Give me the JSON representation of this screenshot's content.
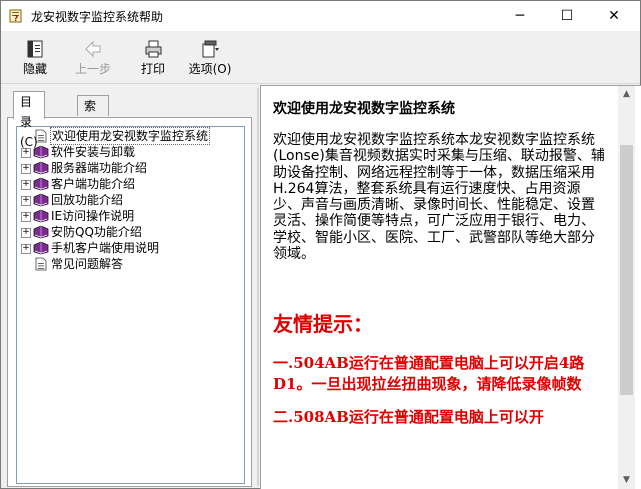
{
  "window": {
    "title": "龙安视数字监控系统帮助",
    "controls": {
      "minimize": "─",
      "maximize": "☐",
      "close": "✕"
    }
  },
  "toolbar": {
    "hide_label": "隐藏",
    "back_label": "上一步",
    "print_label": "打印",
    "options_label": "选项(O)"
  },
  "tabs": [
    {
      "label": "目录(C)",
      "active": true
    },
    {
      "label": "索引(N)",
      "active": false
    }
  ],
  "tree": {
    "items": [
      {
        "label": "欢迎使用龙安视数字监控系统",
        "icon": "page-icon",
        "expandable": false,
        "selected": true
      },
      {
        "label": "软件安装与卸载",
        "icon": "book-icon",
        "expandable": true
      },
      {
        "label": "服务器端功能介绍",
        "icon": "book-icon",
        "expandable": true
      },
      {
        "label": "客户端功能介绍",
        "icon": "book-icon",
        "expandable": true
      },
      {
        "label": "回放功能介绍",
        "icon": "book-icon",
        "expandable": true
      },
      {
        "label": "IE访问操作说明",
        "icon": "book-icon",
        "expandable": true
      },
      {
        "label": "安防QQ功能介绍",
        "icon": "book-icon",
        "expandable": true
      },
      {
        "label": "手机客户端使用说明",
        "icon": "book-icon",
        "expandable": true
      },
      {
        "label": "常见问题解答",
        "icon": "page-icon",
        "expandable": false
      }
    ]
  },
  "content": {
    "heading": "欢迎使用龙安视数字监控系统",
    "body": "欢迎使用龙安视数字监控系统本龙安视数字监控系统(Lonse)集音视频数据实时采集与压缩、联动报警、辅助设备控制、网络远程控制等于一体，数据压缩采用H.264算法，整套系统具有运行速度快、占用资源少、声音与画质清晰、录像时间长、性能稳定、设置灵活、操作简便等特点，可广泛应用于银行、电力、学校、智能小区、医院、工厂、武警部队等绝大部分领域。",
    "tip_title": "友情提示：",
    "tip_items": [
      "一.504AB运行在普通配置电脑上可以开启4路D1。一旦出现拉丝扭曲现象，请降低录像帧数",
      "二.508AB运行在普通配置电脑上可以开"
    ]
  },
  "colors": {
    "tip_red": "#e00000",
    "book_purple": "#7b2d8e"
  }
}
